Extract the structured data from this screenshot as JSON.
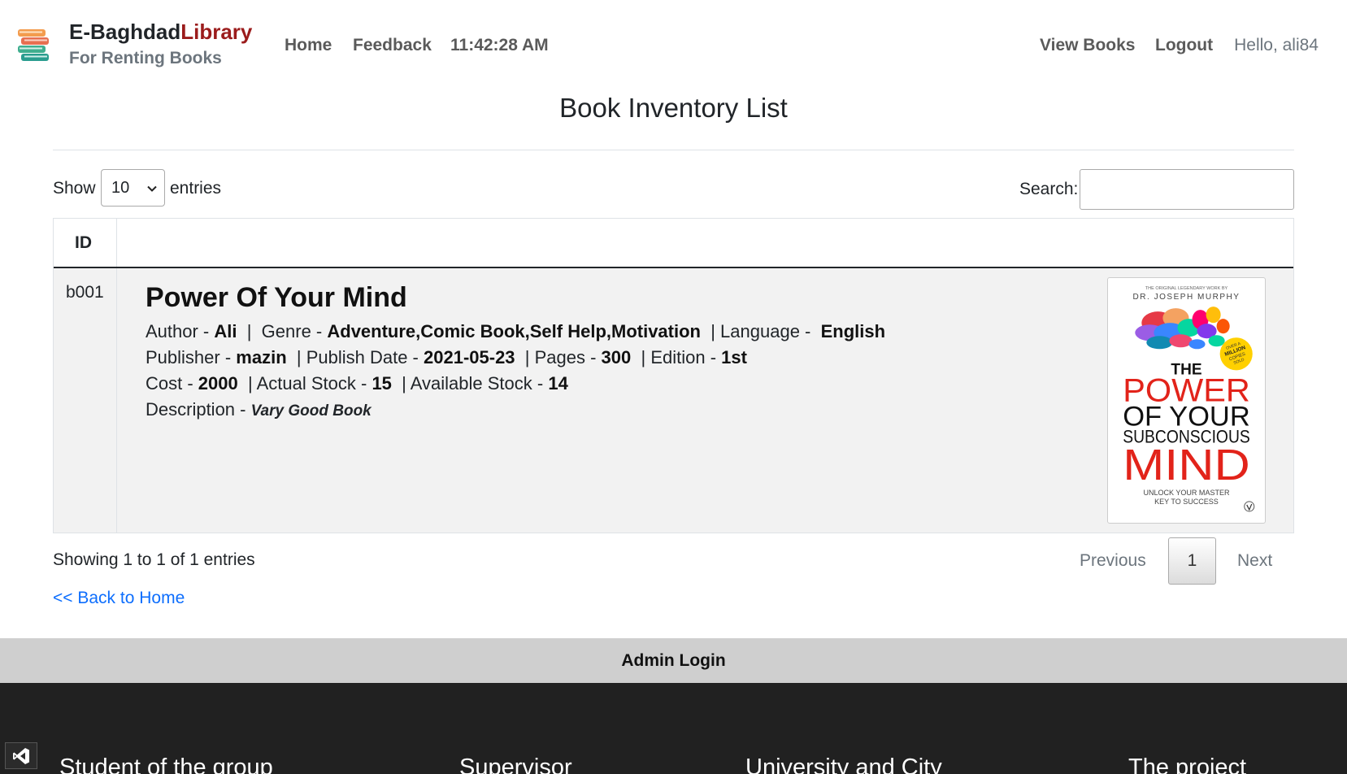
{
  "header": {
    "brand_main": "E-Baghdad",
    "brand_accent": "Library",
    "brand_sub": "For Renting Books",
    "nav_left": [
      "Home",
      "Feedback"
    ],
    "clock": "11:42:28 AM",
    "nav_right": [
      "View Books",
      "Logout"
    ],
    "greeting": "Hello, ali84",
    "logo_icon": "books-stack-icon"
  },
  "page": {
    "title": "Book Inventory List"
  },
  "table_controls": {
    "show_label": "Show",
    "entries_value": "10",
    "entries_label": "entries",
    "search_label": "Search:",
    "search_value": ""
  },
  "table": {
    "columns": [
      "ID",
      ""
    ],
    "rows": [
      {
        "id": "b001",
        "title": "Power Of Your Mind",
        "author_label": "Author - ",
        "author": "Ali",
        "genre_label": "Genre - ",
        "genre": "Adventure,Comic Book,Self Help,Motivation",
        "language_label": "Language - ",
        "language": "English",
        "publisher_label": "Publisher - ",
        "publisher": "mazin",
        "publish_date_label": "Publish Date - ",
        "publish_date": "2021-05-23",
        "pages_label": "Pages - ",
        "pages": "300",
        "edition_label": "Edition - ",
        "edition": "1st",
        "cost_label": "Cost - ",
        "cost": "2000",
        "actual_stock_label": "Actual Stock - ",
        "actual_stock": "15",
        "available_stock_label": "Available Stock - ",
        "available_stock": "14",
        "description_label": "Description - ",
        "description": "Vary Good Book",
        "cover": {
          "top_line": "THE ORIGINAL LEGENDARY WORK BY",
          "author": "DR. JOSEPH MURPHY",
          "badge": [
            "OVER A",
            "MILLION",
            "COPIES",
            "SOLD"
          ],
          "the": "THE",
          "power": "POWER",
          "of_your": "OF YOUR",
          "subconscious": "SUBCONSCIOUS",
          "mind": "MIND",
          "tagline": [
            "UNLOCK YOUR MASTER",
            "KEY TO SUCCESS"
          ]
        }
      }
    ]
  },
  "pagination": {
    "info": "Showing 1 to 1 of 1 entries",
    "previous": "Previous",
    "current": "1",
    "next": "Next"
  },
  "back_link": "<< Back to Home",
  "admin_bar": "Admin Login",
  "footer": {
    "headings": [
      "Student of the group",
      "Supervisor",
      "University and City",
      "The project"
    ]
  },
  "colors": {
    "accent_red": "#9b1c1c",
    "link_blue": "#0d6efd",
    "footer_bg": "#212121",
    "admin_bar_bg": "#cfcfcf"
  }
}
